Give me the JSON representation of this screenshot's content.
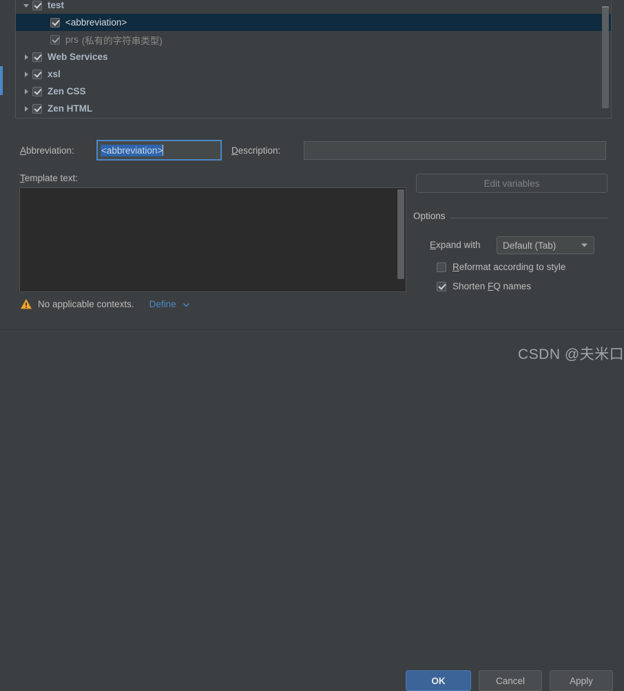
{
  "tree": {
    "rows": [
      {
        "label": "test",
        "expander": "expanded",
        "checked": true,
        "bold": true,
        "level": 1,
        "selected": false,
        "sub": ""
      },
      {
        "label": "<abbreviation>",
        "expander": "none",
        "checked": true,
        "bold": false,
        "level": 2,
        "selected": true,
        "sub": ""
      },
      {
        "label": "prs",
        "expander": "none",
        "checked": true,
        "bold": false,
        "level": 2,
        "selected": false,
        "sub": "(私有的字符串类型)"
      },
      {
        "label": "Web Services",
        "expander": "collapsed",
        "checked": true,
        "bold": true,
        "level": 1,
        "selected": false,
        "sub": ""
      },
      {
        "label": "xsl",
        "expander": "collapsed",
        "checked": true,
        "bold": true,
        "level": 1,
        "selected": false,
        "sub": ""
      },
      {
        "label": "Zen CSS",
        "expander": "collapsed",
        "checked": true,
        "bold": true,
        "level": 1,
        "selected": false,
        "sub": ""
      },
      {
        "label": "Zen HTML",
        "expander": "collapsed",
        "checked": true,
        "bold": true,
        "level": 1,
        "selected": false,
        "sub": ""
      }
    ],
    "scrollbar_name": "tree-vertical-scrollbar"
  },
  "form": {
    "abbreviation_label": "Abbreviation:",
    "abbreviation_value": "<abbreviation>",
    "description_label": "Description:",
    "description_value": "",
    "template_text_label": "Template text:",
    "template_text_value": ""
  },
  "right": {
    "edit_variables_label": "Edit variables",
    "options_title": "Options",
    "expand_with_label": "Expand with",
    "expand_with_value": "Default (Tab)",
    "reformat_label": "Reformat according to style",
    "reformat_checked": false,
    "shorten_label": "Shorten FQ names",
    "shorten_checked": true
  },
  "status": {
    "warning_text": "No applicable contexts.",
    "define_label": "Define"
  },
  "buttons": {
    "ok": "OK",
    "cancel": "Cancel",
    "apply": "Apply"
  },
  "watermark": {
    "text": "CSDN @夫米口"
  },
  "colors": {
    "background": "#3c3f41",
    "selection": "#0f2b3f",
    "accent": "#4a88c7",
    "text_selection": "#2f65ad",
    "warning": "#f0a732",
    "editor_bg": "#2b2b2b",
    "ok_button": "#3c6498"
  }
}
